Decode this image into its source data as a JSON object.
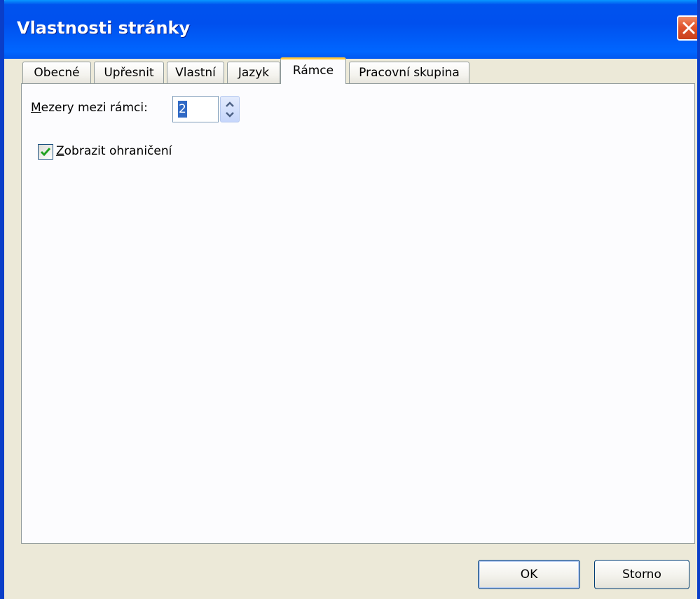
{
  "window": {
    "title": "Vlastnosti stránky"
  },
  "tabs": [
    {
      "label": "Obecné",
      "active": false
    },
    {
      "label": "Upřesnit",
      "active": false
    },
    {
      "label": "Vlastní",
      "active": false
    },
    {
      "label": "Jazyk",
      "active": false
    },
    {
      "label": "Rámce",
      "active": true
    },
    {
      "label": "Pracovní skupina",
      "active": false
    }
  ],
  "frames": {
    "spacing_label_accel": "M",
    "spacing_label_rest": "ezery mezi rámci:",
    "spacing_value": "2",
    "border_checked": true,
    "border_label_accel": "Z",
    "border_label_rest": "obrazit ohraničení"
  },
  "buttons": {
    "ok_label": "OK",
    "cancel_label": "Storno"
  },
  "icons": {
    "close": "close-icon",
    "spin_up": "chevron-up-icon",
    "spin_down": "chevron-down-icon",
    "check": "checkmark-icon"
  },
  "colors": {
    "titlebar": "#0058ee",
    "close_button": "#e0542e",
    "active_tab_accent": "#ffc83c",
    "selection": "#316ac5",
    "checkmark": "#21a121"
  }
}
